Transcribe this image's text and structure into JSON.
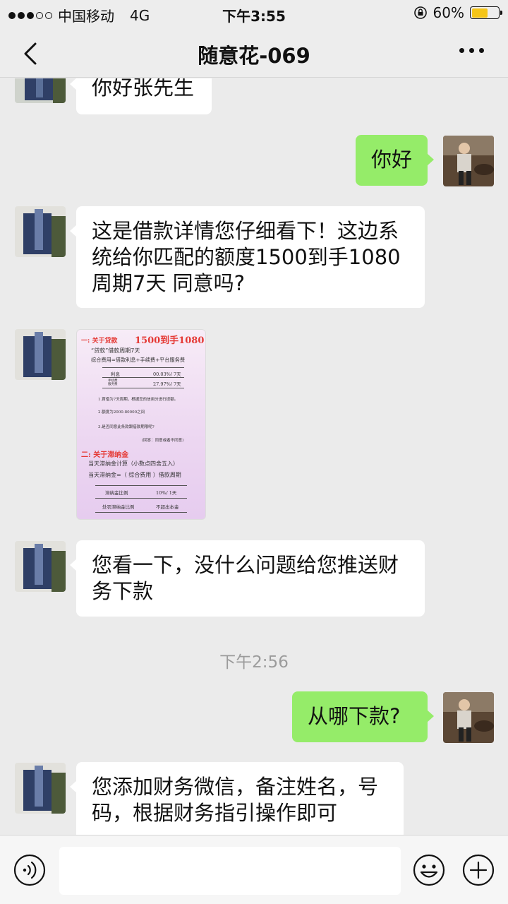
{
  "status_bar": {
    "carrier": "中国移动",
    "network": "4G",
    "time": "下午3:55",
    "battery_percent": "60%",
    "battery_level": 0.6,
    "signal_bars_filled": 3,
    "signal_bars_total": 5
  },
  "nav": {
    "title": "随意花-069",
    "back_icon": "chevron-left-icon",
    "more_icon": "more-dots-icon"
  },
  "messages": [
    {
      "side": "in",
      "lines": [
        "你好张先生"
      ]
    },
    {
      "side": "out",
      "lines": [
        "你好"
      ]
    },
    {
      "side": "in",
      "lines": [
        "这是借款详情您仔细看下！这边系",
        "统给你匹配的额度1500到手1080",
        "周期7天 同意吗?"
      ]
    },
    {
      "side": "in",
      "type": "image"
    },
    {
      "side": "in",
      "lines": [
        "您看一下，没什么问题给您推送财",
        "务下款"
      ]
    },
    {
      "side": "out",
      "lines": [
        "从哪下款?"
      ]
    },
    {
      "side": "in",
      "lines": [
        "您添加财务微信，备注姓名，号",
        "码，根据财务指引操作即可"
      ]
    }
  ],
  "timestamp": "下午2:56",
  "loan_image": {
    "heading1": "一: 关于贷款",
    "headline": "1500到手1080",
    "line1": "“贷款”借款周期7天",
    "line2": "综合费用=借款利息+手续费+平台服务费",
    "table1": [
      {
        "label": "利息",
        "value": "00.03%/ 7天"
      },
      {
        "label": "手续费\n服务费",
        "value": "27.97%/ 7天"
      }
    ],
    "note1": "1.首借为7天周期，根据您的信用分进行提额。",
    "note2": "2.额度为2000-80000之间",
    "note3": "3.是否同意此条款跟借款期限呢?",
    "reply": "(回答：同意或者不同意)",
    "heading2": "二: 关于滞纳金",
    "line3": "当天滞纳金计算（小数点四舍五入）",
    "line4": "当天滞纳金=（ 综合费用 ）借款周期",
    "table2": [
      {
        "label": "滞纳金比例",
        "value": "10%/ 1天"
      },
      {
        "label": "处罚滞纳金比例",
        "value": "不超出本金"
      }
    ]
  },
  "input_bar": {
    "placeholder": "",
    "voice_icon": "voice-icon",
    "emoji_icon": "emoji-icon",
    "plus_icon": "plus-icon"
  }
}
